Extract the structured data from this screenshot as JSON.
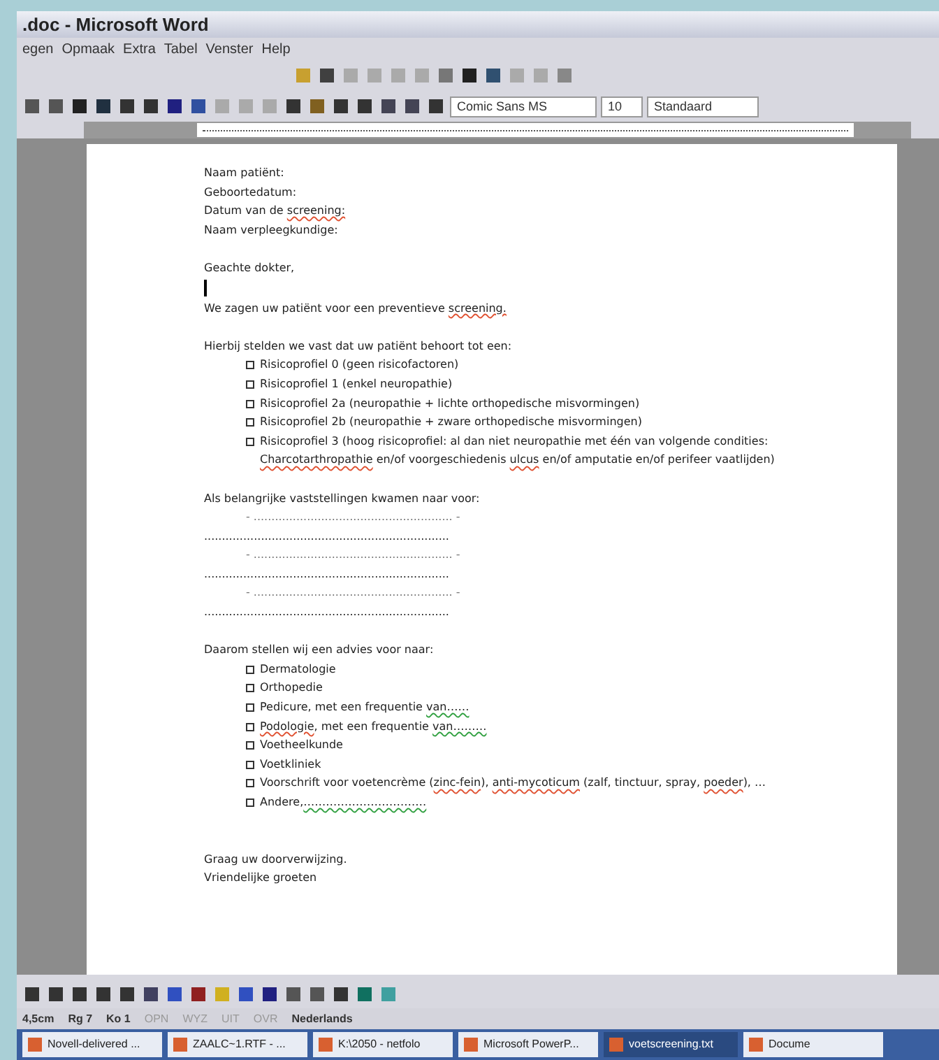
{
  "window": {
    "title": ".doc - Microsoft Word"
  },
  "menu": [
    "egen",
    "Opmaak",
    "Extra",
    "Tabel",
    "Venster",
    "Help"
  ],
  "formatting_toolbar": {
    "font": "Comic Sans MS",
    "size": "10",
    "style": "Standaard"
  },
  "document": [
    {
      "kind": "line",
      "text": "Naam patiënt:"
    },
    {
      "kind": "line",
      "text": "Geboortedatum:"
    },
    {
      "kind": "line",
      "segments": [
        {
          "text": "Datum van de ",
          "spelling_error": false,
          "grammar_error": false
        },
        {
          "text": "screening:",
          "spelling_error": true,
          "grammar_error": false
        }
      ]
    },
    {
      "kind": "line",
      "text": "Naam verpleegkundige:"
    },
    {
      "kind": "gap"
    },
    {
      "kind": "line",
      "text": "Geachte dokter,"
    },
    {
      "kind": "cursor"
    },
    {
      "kind": "line",
      "segments": [
        {
          "text": "We zagen uw patiënt voor een preventieve ",
          "spelling_error": false,
          "grammar_error": false
        },
        {
          "text": "screening.",
          "spelling_error": true,
          "grammar_error": false
        }
      ]
    },
    {
      "kind": "gap"
    },
    {
      "kind": "line",
      "text": "Hierbij stelden we vast dat uw patiënt behoort tot een:"
    },
    {
      "kind": "bullet",
      "text": "Risicoprofiel 0 (geen risicofactoren)"
    },
    {
      "kind": "bullet",
      "text": "Risicoprofiel 1 (enkel neuropathie)"
    },
    {
      "kind": "bullet",
      "text": "Risicoprofiel 2a (neuropathie + lichte orthopedische misvormingen)"
    },
    {
      "kind": "bullet",
      "text": "Risicoprofiel 2b (neuropathie + zware orthopedische misvormingen)"
    },
    {
      "kind": "bullet",
      "segments": [
        {
          "text": "Risicoprofiel 3 (hoog risicoprofiel: al dan niet neuropathie met één van volgende condities: ",
          "spelling_error": false,
          "grammar_error": false
        },
        {
          "text": "Charcotarthropathie",
          "spelling_error": true,
          "grammar_error": false
        },
        {
          "text": " en/of voorgeschiedenis ",
          "spelling_error": false,
          "grammar_error": false
        },
        {
          "text": "ulcus",
          "spelling_error": true,
          "grammar_error": false
        },
        {
          "text": " en/of amputatie en/of perifeer vaatlijden)",
          "spelling_error": false,
          "grammar_error": false
        }
      ]
    },
    {
      "kind": "gap"
    },
    {
      "kind": "line",
      "text": "Als belangrijke vaststellingen kwamen naar voor:"
    },
    {
      "kind": "dots",
      "text": "- ........................................................ -"
    },
    {
      "kind": "line",
      "text": "....................................................................."
    },
    {
      "kind": "dots",
      "text": "- ........................................................ -"
    },
    {
      "kind": "line",
      "text": "....................................................................."
    },
    {
      "kind": "dots",
      "text": "- ........................................................ -"
    },
    {
      "kind": "line",
      "text": "....................................................................."
    },
    {
      "kind": "gap"
    },
    {
      "kind": "line",
      "text": "Daarom stellen wij een advies voor naar:"
    },
    {
      "kind": "bullet",
      "text": "Dermatologie"
    },
    {
      "kind": "bullet",
      "text": "Orthopedie"
    },
    {
      "kind": "bullet",
      "segments": [
        {
          "text": "Pedicure, met een frequentie ",
          "spelling_error": false,
          "grammar_error": false
        },
        {
          "text": "van……",
          "spelling_error": false,
          "grammar_error": true
        }
      ]
    },
    {
      "kind": "bullet",
      "segments": [
        {
          "text": "Podologie",
          "spelling_error": true,
          "grammar_error": false
        },
        {
          "text": ", met een frequentie ",
          "spelling_error": false,
          "grammar_error": false
        },
        {
          "text": "van………",
          "spelling_error": false,
          "grammar_error": true
        }
      ]
    },
    {
      "kind": "bullet",
      "text": "Voetheelkunde"
    },
    {
      "kind": "bullet",
      "text": "Voetkliniek"
    },
    {
      "kind": "bullet",
      "segments": [
        {
          "text": "Voorschrift voor voetencrème (",
          "spelling_error": false,
          "grammar_error": false
        },
        {
          "text": "zinc-fein",
          "spelling_error": true,
          "grammar_error": false
        },
        {
          "text": "), ",
          "spelling_error": false,
          "grammar_error": false
        },
        {
          "text": "anti-mycoticum",
          "spelling_error": true,
          "grammar_error": false
        },
        {
          "text": " (zalf, tinctuur, spray, ",
          "spelling_error": false,
          "grammar_error": false
        },
        {
          "text": "poeder",
          "spelling_error": true,
          "grammar_error": false
        },
        {
          "text": "), …",
          "spelling_error": false,
          "grammar_error": false
        }
      ]
    },
    {
      "kind": "bullet",
      "segments": [
        {
          "text": "Andere,",
          "spelling_error": false,
          "grammar_error": false
        },
        {
          "text": "……………………………",
          "spelling_error": false,
          "grammar_error": true
        }
      ]
    },
    {
      "kind": "gap"
    },
    {
      "kind": "gap"
    },
    {
      "kind": "line",
      "text": "Graag uw doorverwijzing."
    },
    {
      "kind": "line",
      "text": "Vriendelijke groeten"
    }
  ],
  "status_bar": [
    "4,5cm",
    "Rg 7",
    "Ko 1",
    "OPN",
    "WYZ",
    "UIT",
    "OVR",
    "Nederlands"
  ],
  "taskbar": [
    "Novell-delivered ...",
    "ZAALC~1.RTF - ...",
    "K:\\2050 - netfolo",
    "Microsoft PowerP...",
    "voetscreening.txt",
    "Docume"
  ]
}
